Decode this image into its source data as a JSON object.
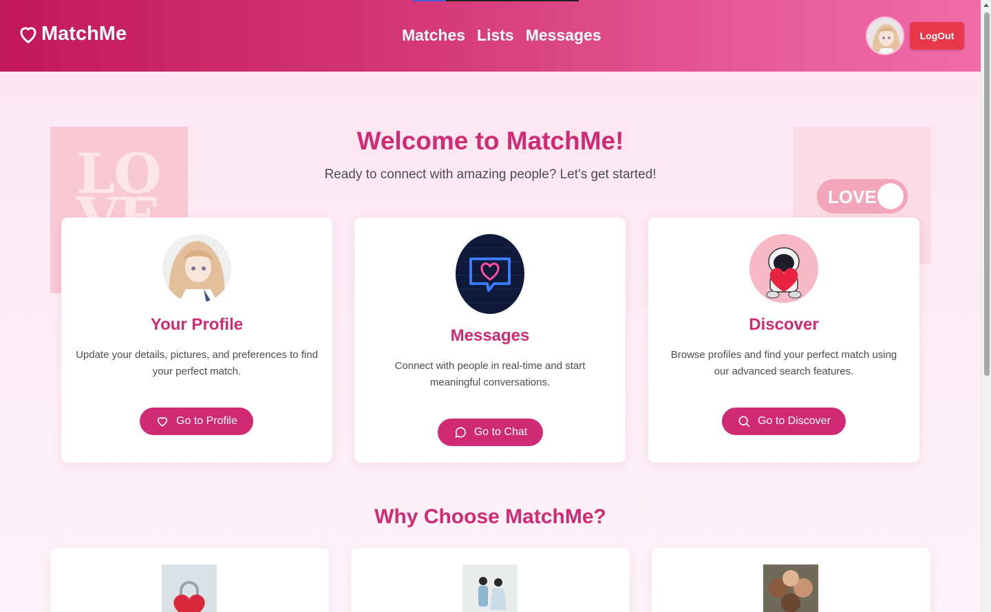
{
  "nav": {
    "brand": "MatchMe",
    "links": [
      "Matches",
      "Lists",
      "Messages"
    ],
    "logout_label": "LogOut"
  },
  "decorations": {
    "left_text": "LOVE",
    "right_text": "LOVE"
  },
  "hero": {
    "title": "Welcome to MatchMe!",
    "subtitle": "Ready to connect with amazing people? Let's get started!"
  },
  "cards": [
    {
      "title": "Your Profile",
      "description": "Update your details, pictures, and preferences to find your perfect match.",
      "button_label": "Go to Profile",
      "icon": "heart-icon"
    },
    {
      "title": "Messages",
      "description": "Connect with people in real-time and start meaningful conversations.",
      "button_label": "Go to Chat",
      "icon": "chat-bubble-icon"
    },
    {
      "title": "Discover",
      "description": "Browse profiles and find your perfect match using our advanced search features.",
      "button_label": "Go to Discover",
      "icon": "search-icon"
    }
  ],
  "why": {
    "title": "Why Choose MatchMe?"
  },
  "colors": {
    "accent": "#d12a74",
    "header_start": "#c2185b",
    "header_end": "#f06ba8",
    "logout": "#e8364a"
  }
}
